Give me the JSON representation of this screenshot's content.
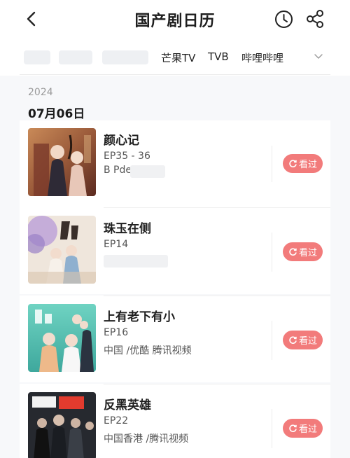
{
  "header": {
    "title": "国产剧日历",
    "back_icon": "chevron-left-icon",
    "history_icon": "clock-icon",
    "share_icon": "share-icon"
  },
  "tabs": [
    "芒果TV",
    "TVB",
    "哔哩哔哩"
  ],
  "section": {
    "year": "2024",
    "date": "07月06日"
  },
  "shows": [
    {
      "title": "颜心记",
      "episodes": "EP35 - 36",
      "platform": "B Pde",
      "watched_label": "看过"
    },
    {
      "title": "珠玉在侧",
      "episodes": "EP14",
      "platform": "",
      "watched_label": "看过"
    },
    {
      "title": "上有老下有小",
      "episodes": "EP16",
      "platform": "中国 /优酷 腾讯视频",
      "watched_label": "看过"
    },
    {
      "title": "反黑英雄",
      "episodes": "EP22",
      "platform": "中国香港 /腾讯视频",
      "watched_label": "看过"
    }
  ],
  "colors": {
    "accent": "#f27b7b",
    "background": "#f7f8fa"
  }
}
